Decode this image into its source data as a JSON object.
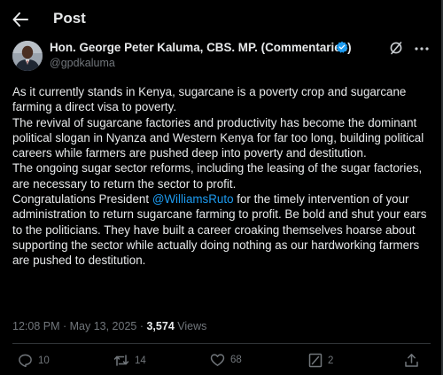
{
  "header": {
    "title": "Post"
  },
  "author": {
    "name": "Hon. George Peter Kaluma, CBS. MP. (Commentaries)",
    "handle": "@gpdkaluma",
    "verified_color": "#1d9bf0"
  },
  "post": {
    "p1": "As it currently stands in Kenya, sugarcane is a poverty crop and sugarcane farming a direct visa to poverty.",
    "p2": "The revival of sugarcane factories and productivity has become the dominant political slogan in Nyanza and Western Kenya for far too long, building political careers while farmers are pushed deep into poverty and destitution.",
    "p3": "The ongoing sugar sector reforms, including the leasing of the sugar factories, are necessary to return the sector to profit.",
    "p4_before": "Congratulations President ",
    "p4_mention": "@WilliamsRuto",
    "p4_after": " for the timely intervention of your administration to return sugarcane farming to profit. Be bold and shut your ears to the politicians. They have built a career croaking themselves hoarse about supporting the sector while actually doing nothing as our hardworking farmers are pushed to destitution."
  },
  "meta": {
    "time": "12:08 PM",
    "separator": " · ",
    "date": "May 13, 2025",
    "views_count": "3,574",
    "views_label": " Views"
  },
  "actions": {
    "replies": "10",
    "reposts": "14",
    "likes": "68",
    "bookmarks": "2"
  },
  "colors": {
    "background": "#000000",
    "text": "#e7e9ea",
    "muted": "#71767b",
    "accent": "#1d9bf0",
    "divider": "#2f3336"
  },
  "icons": {
    "back": "arrow-left-icon",
    "grok": "grok-icon",
    "more": "more-horizontal-icon",
    "reply": "reply-icon",
    "repost": "repost-icon",
    "like": "heart-icon",
    "bookmark": "bookmark-icon",
    "share": "share-icon"
  }
}
